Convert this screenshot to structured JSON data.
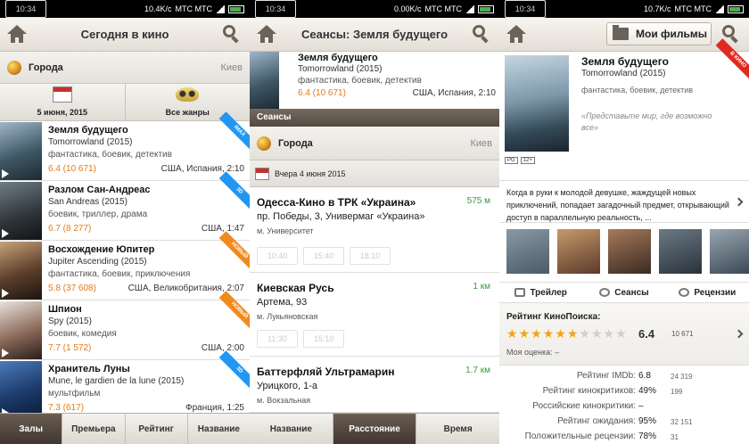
{
  "status": [
    {
      "time": "10:34",
      "speed": "10.4K/c",
      "carriers": "МТС МТС"
    },
    {
      "time": "10:34",
      "speed": "0.00K/c",
      "carriers": "МТС МТС"
    },
    {
      "time": "10:34",
      "speed": "10.7K/c",
      "carriers": "МТС МТС"
    }
  ],
  "p1": {
    "title": "Сегодня в кино",
    "city_label": "Города",
    "city_value": "Киев",
    "filter_date": "5 июня, 2015",
    "filter_genre": "Все жанры",
    "movies": [
      {
        "name": "Земля будущего",
        "orig": "Tomorrowland (2015)",
        "genre": "фантастика, боевик, детектив",
        "rating": "6.4 (10 671)",
        "country": "США, Испания, 2:10",
        "ribbon": "IMAX",
        "ribbon_color": "#2196f3",
        "poster": "linear-gradient(160deg,#9fb6c8,#3f5866 55%,#1c2a33)"
      },
      {
        "name": "Разлом Сан-Андреас",
        "orig": "San Andreas (2015)",
        "genre": "боевик, триллер, драма",
        "rating": "6.7 (8 277)",
        "country": "США, 1:47",
        "ribbon": "3D",
        "ribbon_color": "#2196f3",
        "poster": "linear-gradient(160deg,#6f7d86,#2d3338 60%,#121416)"
      },
      {
        "name": "Восхождение Юпитер",
        "orig": "Jupiter Ascending (2015)",
        "genre": "фантастика, боевик, приключения",
        "rating": "5.8 (37 608)",
        "country": "США, Великобритания, 2:07",
        "ribbon": "НОВЫЙ",
        "ribbon_color": "#f08a1e",
        "poster": "linear-gradient(160deg,#c7a27a,#5a3e2a 55%,#1d140e)"
      },
      {
        "name": "Шпион",
        "orig": "Spy (2015)",
        "genre": "боевик, комедия",
        "rating": "7.7 (1 572)",
        "country": "США, 2:00",
        "ribbon": "НОВЫЙ",
        "ribbon_color": "#f08a1e",
        "poster": "linear-gradient(160deg,#e7e2da,#8c6a5a 55%,#2a1e1a)"
      },
      {
        "name": "Хранитель Луны",
        "orig": "Mune, le gardien de la lune (2015)",
        "genre": "мультфильм",
        "rating": "7.3 (617)",
        "country": "Франция, 1:25",
        "ribbon": "3D",
        "ribbon_color": "#2196f3",
        "poster": "linear-gradient(160deg,#4a7bb8,#1c3a6a 55%,#0b1a33)"
      }
    ],
    "tabs": [
      "Залы",
      "Премьера",
      "Рейтинг",
      "Название"
    ]
  },
  "p2": {
    "title": "Сеансы: Земля будущего",
    "movie": {
      "name": "Земля будущего",
      "orig": "Tomorrowland (2015)",
      "genre": "фантастика, боевик, детектив",
      "rating": "6.4 (10 671)",
      "country": "США, Испания, 2:10"
    },
    "section": "Сеансы",
    "city_label": "Города",
    "city_value": "Киев",
    "date_label": "Вчера 4 июня 2015",
    "cinemas": [
      {
        "name": "Одесса-Кино в ТРК «Украина»",
        "distance": "575 м",
        "address": "пр. Победы, 3, Универмаг «Украина»",
        "metro": "м. Университет",
        "times": [
          "10:40",
          "15:40",
          "18:10"
        ]
      },
      {
        "name": "Киевская Русь",
        "distance": "1 км",
        "address": "Артема, 93",
        "metro": "м. Лукьяновская",
        "times": [
          "11:30",
          "15:10"
        ]
      },
      {
        "name": "Баттерфляй Ультрамарин",
        "distance": "1.7 км",
        "address": "Урицкого, 1-а",
        "metro": "м. Вокзальная",
        "times": []
      }
    ],
    "tabs": [
      "Название",
      "Расстояние",
      "Время"
    ]
  },
  "p3": {
    "my_films": "Мои фильмы",
    "name": "Земля будущего",
    "orig": "Tomorrowland (2015)",
    "genre": "фантастика, боевик, детектив",
    "tagline": "«Представьте мир, где возможно все»",
    "new_ribbon": "В КИНО",
    "badges": [
      "PG",
      "12+"
    ],
    "description": "Когда в руки к молодой девушке, жаждущей новых приключений, попадает загадочный предмет, открывающий доступ в параллельную реальность, ...",
    "actions": [
      "Трейлер",
      "Сеансы",
      "Рецензии"
    ],
    "kp_title": "Рейтинг КиноПоиска:",
    "kp_value": "6.4",
    "kp_votes": "10 671",
    "kp_stars_filled": 6,
    "kp_stars_total": 10,
    "my_rating": "Моя оценка:   –",
    "stats": [
      {
        "label": "Рейтинг IMDb:",
        "value": "6.8",
        "count": "24 319"
      },
      {
        "label": "Рейтинг кинокритиков:",
        "value": "49%",
        "count": "199"
      },
      {
        "label": "Российские кинокритики:",
        "value": "–",
        "count": ""
      },
      {
        "label": "Рейтинг ожидания:",
        "value": "95%",
        "count": "32 151"
      },
      {
        "label": "Положительные рецензии:",
        "value": "78%",
        "count": "31"
      }
    ]
  }
}
